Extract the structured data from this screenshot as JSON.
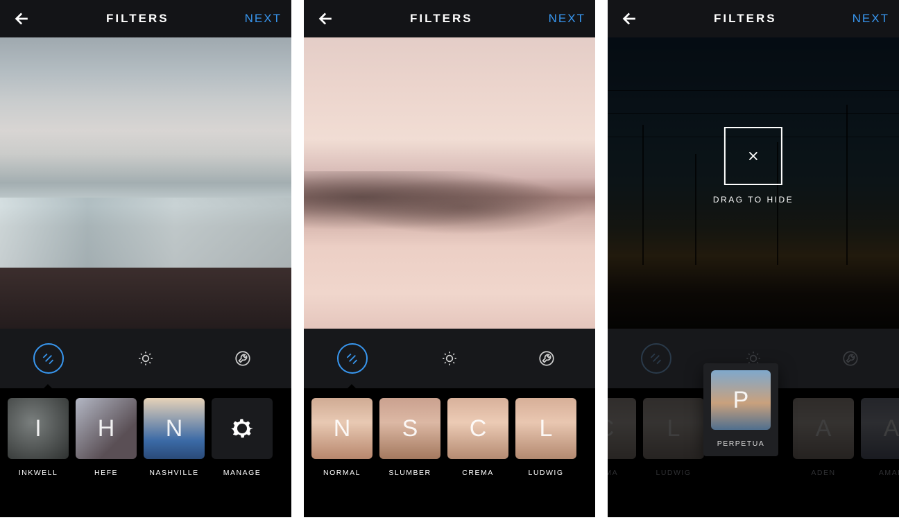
{
  "colors": {
    "accent": "#3897f0"
  },
  "screens": [
    {
      "header": {
        "title": "FILTERS",
        "next": "NEXT"
      },
      "tools": {
        "active": "filters"
      },
      "filters": [
        {
          "letter": "I",
          "label": "INKWELL",
          "bg": "bg-ink"
        },
        {
          "letter": "H",
          "label": "HEFE",
          "bg": "bg-hefe"
        },
        {
          "letter": "N",
          "label": "NASHVILLE",
          "bg": "bg-nash"
        },
        {
          "letter": "",
          "label": "MANAGE",
          "bg": "bg-manage",
          "manage": true
        }
      ]
    },
    {
      "header": {
        "title": "FILTERS",
        "next": "NEXT"
      },
      "tools": {
        "active": "filters"
      },
      "filters": [
        {
          "letter": "N",
          "label": "NORMAL",
          "bg": "bg-normal"
        },
        {
          "letter": "S",
          "label": "SLUMBER",
          "bg": "bg-slumber"
        },
        {
          "letter": "C",
          "label": "CREMA",
          "bg": "bg-crema"
        },
        {
          "letter": "L",
          "label": "LUDWIG",
          "bg": "bg-ludwig"
        }
      ]
    },
    {
      "header": {
        "title": "FILTERS",
        "next": "NEXT"
      },
      "drop_label": "DRAG TO HIDE",
      "drag_filter": {
        "letter": "P",
        "label": "PERPETUA",
        "bg": "bg-perpetua"
      },
      "filters_dim": [
        {
          "letter": "C",
          "label": "REMA",
          "bg": "bg-crema",
          "partial": "left"
        },
        {
          "letter": "L",
          "label": "LUDWIG",
          "bg": "bg-ludwig"
        },
        {
          "letter": "",
          "label": "",
          "gap": true
        },
        {
          "letter": "A",
          "label": "ADEN",
          "bg": "bg-aden"
        },
        {
          "letter": "A",
          "label": "AMAR",
          "bg": "bg-amaro",
          "partial": "right"
        }
      ]
    }
  ]
}
